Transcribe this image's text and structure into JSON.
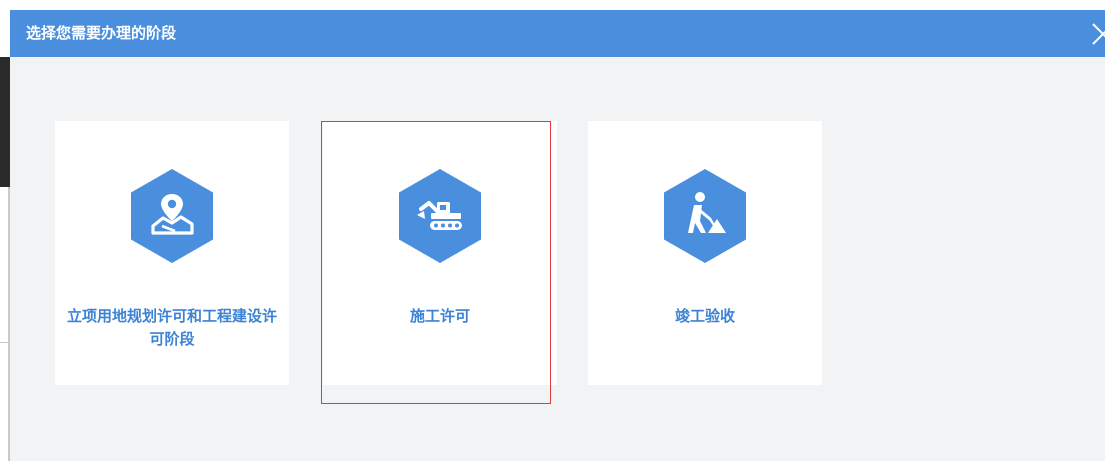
{
  "dialog": {
    "title": "选择您需要办理的阶段"
  },
  "stages": [
    {
      "label": "立项用地规划许可和工程建设许可阶段",
      "icon": "map-location-icon"
    },
    {
      "label": "施工许可",
      "icon": "excavator-icon",
      "selected": true
    },
    {
      "label": "竣工验收",
      "icon": "construction-worker-icon"
    }
  ],
  "colors": {
    "header": "#4a8fde",
    "icon_hex": "#4a8fde",
    "label": "#3d83d5",
    "selection_border": "#e0393e",
    "dialog_bg": "#f2f3f5"
  }
}
